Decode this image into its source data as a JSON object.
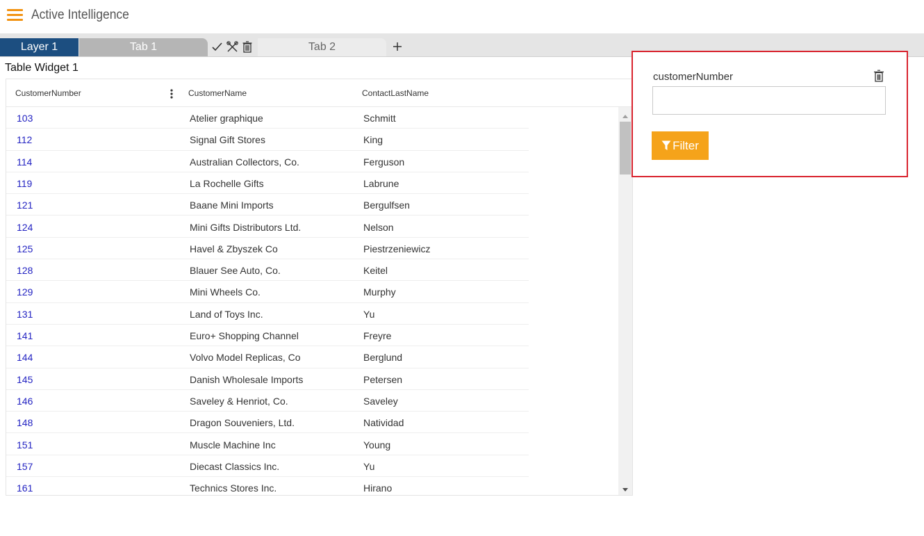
{
  "app": {
    "title": "Active Intelligence",
    "accent_color": "#f29312"
  },
  "tabs": {
    "layer_label": "Layer 1",
    "layer_color": "#1c4e80",
    "items": [
      {
        "label": "Tab 1",
        "active": true
      },
      {
        "label": "Tab 2",
        "active": false
      }
    ],
    "tools": [
      "check-icon",
      "tools-icon",
      "trash-icon"
    ],
    "add_icon": "plus-icon"
  },
  "widget": {
    "title": "Table Widget 1",
    "columns": [
      "CustomerNumber",
      "CustomerName",
      "ContactLastName"
    ],
    "rows": [
      [
        "103",
        "Atelier graphique",
        "Schmitt"
      ],
      [
        "112",
        "Signal Gift Stores",
        "King"
      ],
      [
        "114",
        "Australian Collectors, Co.",
        "Ferguson"
      ],
      [
        "119",
        "La Rochelle Gifts",
        "Labrune"
      ],
      [
        "121",
        "Baane Mini Imports",
        "Bergulfsen"
      ],
      [
        "124",
        "Mini Gifts Distributors Ltd.",
        "Nelson"
      ],
      [
        "125",
        "Havel & Zbyszek Co",
        "Piestrzeniewicz"
      ],
      [
        "128",
        "Blauer See Auto, Co.",
        "Keitel"
      ],
      [
        "129",
        "Mini Wheels Co.",
        "Murphy"
      ],
      [
        "131",
        "Land of Toys Inc.",
        "Yu"
      ],
      [
        "141",
        "Euro+ Shopping Channel",
        "Freyre"
      ],
      [
        "144",
        "Volvo Model Replicas, Co",
        "Berglund"
      ],
      [
        "145",
        "Danish Wholesale Imports",
        "Petersen"
      ],
      [
        "146",
        "Saveley & Henriot, Co.",
        "Saveley"
      ],
      [
        "148",
        "Dragon Souveniers, Ltd.",
        "Natividad"
      ],
      [
        "151",
        "Muscle Machine Inc",
        "Young"
      ],
      [
        "157",
        "Diecast Classics Inc.",
        "Yu"
      ],
      [
        "161",
        "Technics Stores Inc.",
        "Hirano"
      ]
    ]
  },
  "filter": {
    "field_label": "customerNumber",
    "value": "",
    "button_label": "Filter",
    "button_color": "#f5a31a",
    "highlight_color": "#d9232e"
  }
}
